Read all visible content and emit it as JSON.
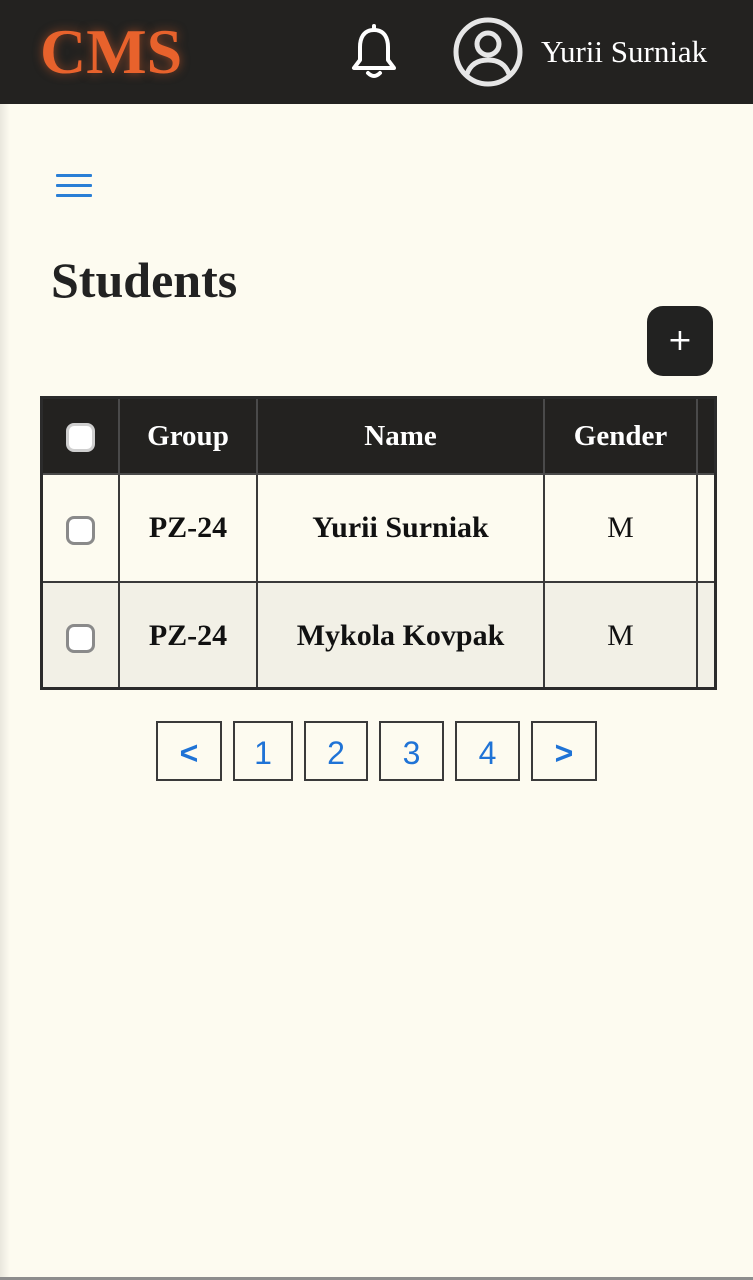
{
  "header": {
    "logo": "CMS",
    "notification_icon": "bell-icon",
    "avatar_icon": "user-circle-icon",
    "username": "Yurii Surniak"
  },
  "toolbar": {
    "menu_icon": "hamburger-menu-icon",
    "add_label": "+"
  },
  "page": {
    "title": "Students"
  },
  "table": {
    "columns": [
      "Group",
      "Name",
      "Gender"
    ],
    "rows": [
      {
        "group": "PZ-24",
        "name": "Yurii Surniak",
        "gender": "M"
      },
      {
        "group": "PZ-24",
        "name": "Mykola Kovpak",
        "gender": "M"
      }
    ]
  },
  "pagination": {
    "prev": "<",
    "pages": [
      "1",
      "2",
      "3",
      "4"
    ],
    "next": ">"
  },
  "colors": {
    "header_bg": "#232220",
    "logo": "#e8622c",
    "page_bg": "#fdfbf0",
    "link_blue": "#1f73d6"
  }
}
